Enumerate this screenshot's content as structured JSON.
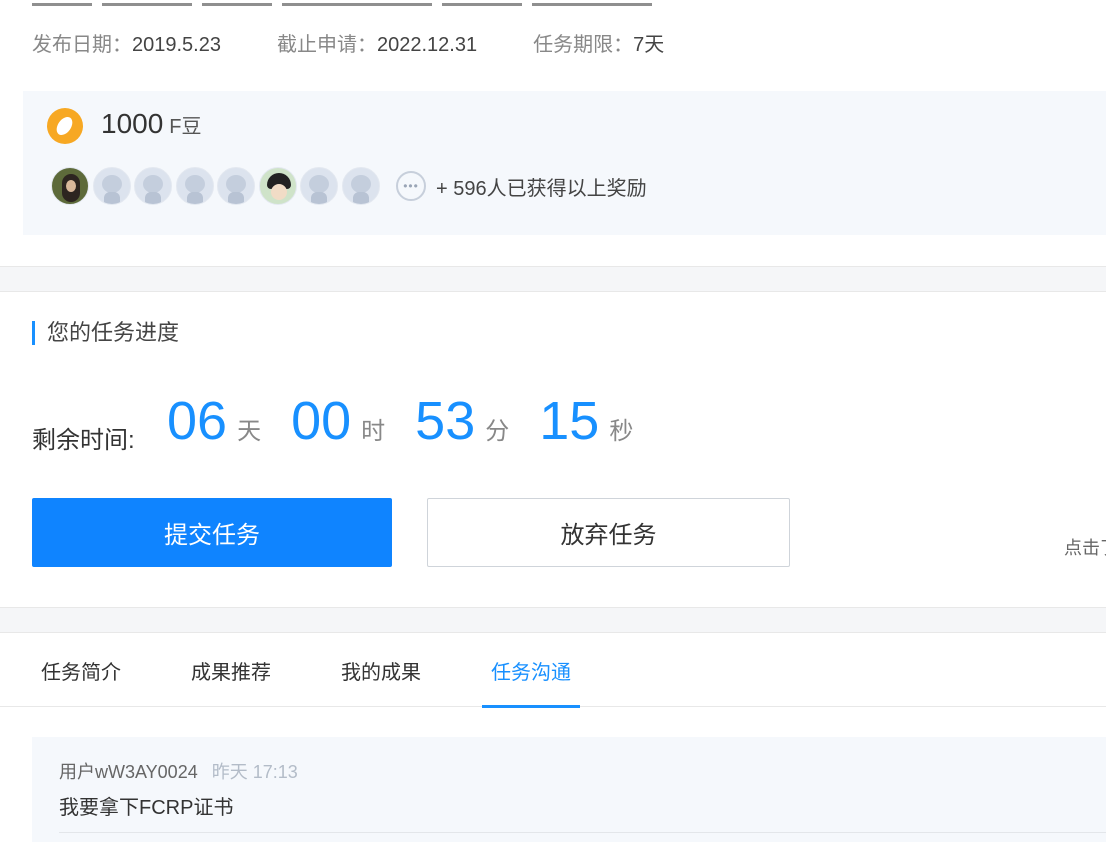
{
  "meta": {
    "publish_label": "发布日期：",
    "publish_value": "2019.5.23",
    "deadline_label": "截止申请：",
    "deadline_value": "2022.12.31",
    "period_label": "任务期限：",
    "period_value": "7天"
  },
  "reward": {
    "amount": "1000",
    "unit": "F豆",
    "more_icon": "ellipsis-icon",
    "gain_text": "+ 596人已获得以上奖励"
  },
  "progress": {
    "title": "您的任务进度",
    "remain_label": "剩余时间:",
    "days": "06",
    "days_unit": "天",
    "hours": "00",
    "hours_unit": "时",
    "minutes": "53",
    "minutes_unit": "分",
    "seconds": "15",
    "seconds_unit": "秒",
    "submit_label": "提交任务",
    "abandon_label": "放弃任务",
    "hint": "点击了"
  },
  "tabs": [
    {
      "label": "任务简介"
    },
    {
      "label": "成果推荐"
    },
    {
      "label": "我的成果"
    },
    {
      "label": "任务沟通"
    }
  ],
  "comments": [
    {
      "user": "用户wW3AY0024",
      "time": "昨天 17:13",
      "text": "我要拿下FCRP证书"
    }
  ],
  "colors": {
    "accent": "#1890ff",
    "primary_button": "#0f84ff",
    "coin": "#f7a823",
    "panel_bg": "#f5f8fc"
  }
}
